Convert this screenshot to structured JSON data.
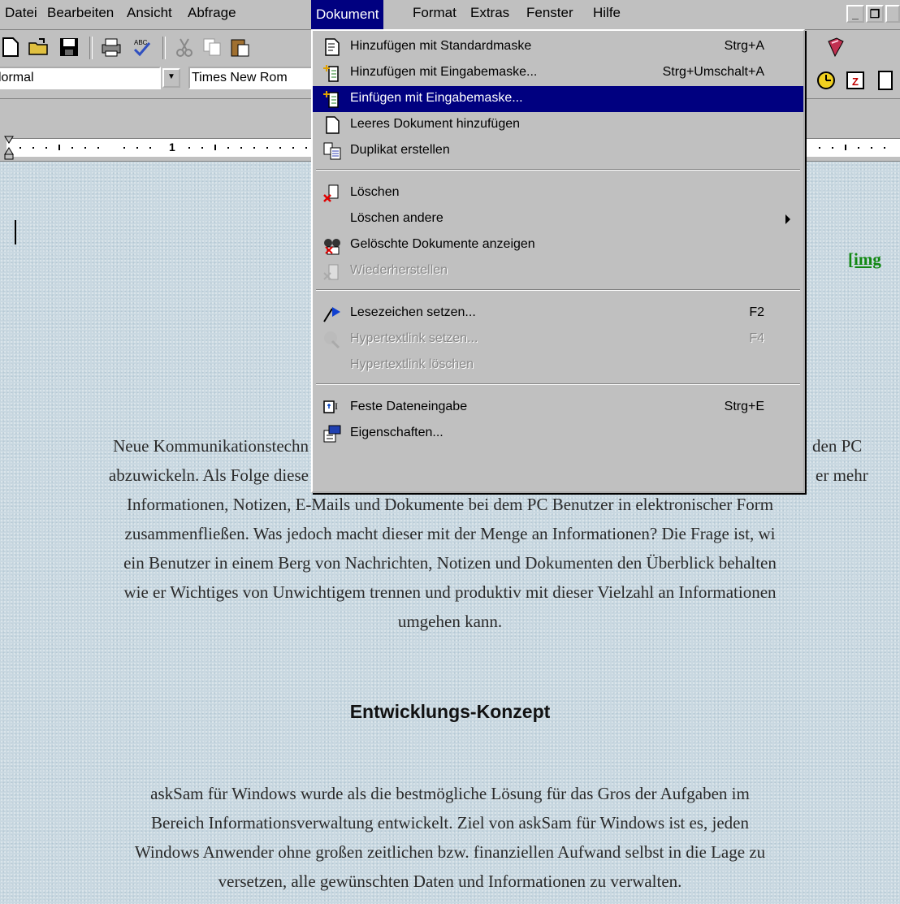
{
  "menubar": {
    "items": [
      "Datei",
      "Bearbeiten",
      "Ansicht",
      "Abfrage",
      "Dokument",
      "Format",
      "Extras",
      "Fenster",
      "Hilfe"
    ],
    "active_item": "Dokument"
  },
  "toolbar": {
    "style_value": "lormal",
    "font_value": "Times New Rom"
  },
  "ruler": {
    "mark_1": "1"
  },
  "dropdown": {
    "items": [
      {
        "label": "Hinzufügen mit Standardmaske",
        "shortcut": "Strg+A",
        "icon": "doc-add-icon"
      },
      {
        "label": "Hinzufügen mit Eingabemaske...",
        "shortcut": "Strg+Umschalt+A",
        "icon": "doc-add-mask-icon"
      },
      {
        "label": "Einfügen mit Eingabemaske...",
        "shortcut": "",
        "icon": "doc-insert-mask-icon",
        "selected": true
      },
      {
        "label": "Leeres Dokument hinzufügen",
        "shortcut": "",
        "icon": "blank-doc-icon"
      },
      {
        "label": "Duplikat erstellen",
        "shortcut": "",
        "icon": "duplicate-icon"
      },
      {
        "label": "Löschen",
        "shortcut": "",
        "icon": "delete-doc-icon"
      },
      {
        "label": "Löschen andere",
        "shortcut": "",
        "icon": "",
        "submenu": true
      },
      {
        "label": "Gelöschte Dokumente anzeigen",
        "shortcut": "",
        "icon": "deleted-docs-icon"
      },
      {
        "label": "Wiederherstellen",
        "shortcut": "",
        "icon": "restore-icon",
        "disabled": true
      },
      {
        "label": "Lesezeichen setzen...",
        "shortcut": "F2",
        "icon": "bookmark-icon"
      },
      {
        "label": "Hypertextlink setzen...",
        "shortcut": "F4",
        "icon": "hyperlink-icon",
        "disabled": true
      },
      {
        "label": "Hypertextlink löschen",
        "shortcut": "",
        "icon": "",
        "disabled": true
      },
      {
        "label": "Feste Dateneingabe",
        "shortcut": "Strg+E",
        "icon": "fixed-input-icon"
      },
      {
        "label": "Eigenschaften...",
        "shortcut": "",
        "icon": "properties-icon"
      }
    ]
  },
  "document": {
    "img_link": "[img",
    "para1_lines": [
      "Neue Kommunikationstechn",
      "den PC",
      "abzuwickeln. Als Folge diese",
      "er mehr",
      "Informationen, Notizen, E-Mails und Dokumente bei dem PC Benutzer in elektronischer Form",
      "zusammenfließen. Was jedoch macht dieser mit der Menge an Informationen? Die Frage ist, wi",
      "ein Benutzer in einem Berg von Nachrichten, Notizen und Dokumenten den Überblick behalten",
      "wie er Wichtiges von Unwichtigem trennen und produktiv mit dieser Vielzahl an Informationen",
      "umgehen kann."
    ],
    "heading": "Entwicklungs-Konzept",
    "para2_lines": [
      "askSam für Windows wurde als die bestmögliche Lösung für das Gros der Aufgaben im",
      "Bereich Informationsverwaltung entwickelt. Ziel von askSam für Windows ist es, jeden",
      "Windows Anwender ohne großen zeitlichen bzw. finanziellen Aufwand selbst in die Lage zu",
      "versetzen, alle gewünschten Daten und Informationen zu verwalten."
    ]
  }
}
